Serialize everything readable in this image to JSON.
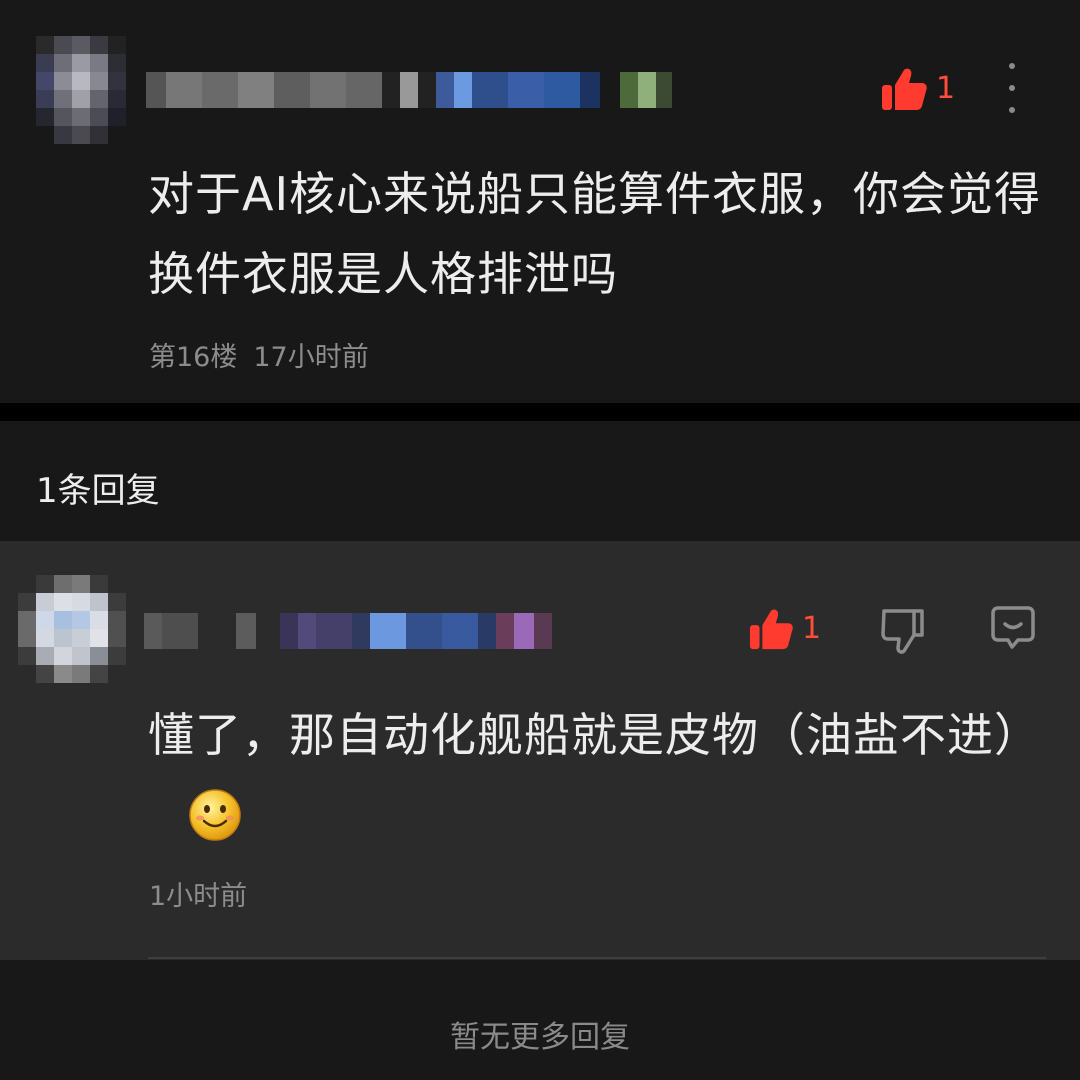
{
  "comment": {
    "like_count": "1",
    "text": "对于AI核心来说船只能算件衣服，你会觉得换件衣服是人格排泄吗",
    "floor": "第16楼",
    "time": "17小时前"
  },
  "replies_header": {
    "label": "1条回复"
  },
  "reply": {
    "like_count": "1",
    "text": "懂了，那自动化舰船就是皮物（油盐不进）",
    "time": "1小时前"
  },
  "footer": {
    "label": "暂无更多回复"
  },
  "icons": {
    "like": "thumbs-up-icon",
    "dislike": "thumbs-down-icon",
    "reply": "comment-bubble-icon",
    "more": "more-vertical-icon",
    "emoji": "smiley-emoji-icon"
  },
  "colors": {
    "accent_like": "#ff3b2f",
    "text_primary": "#ededed",
    "text_secondary": "#8c8c8c"
  }
}
